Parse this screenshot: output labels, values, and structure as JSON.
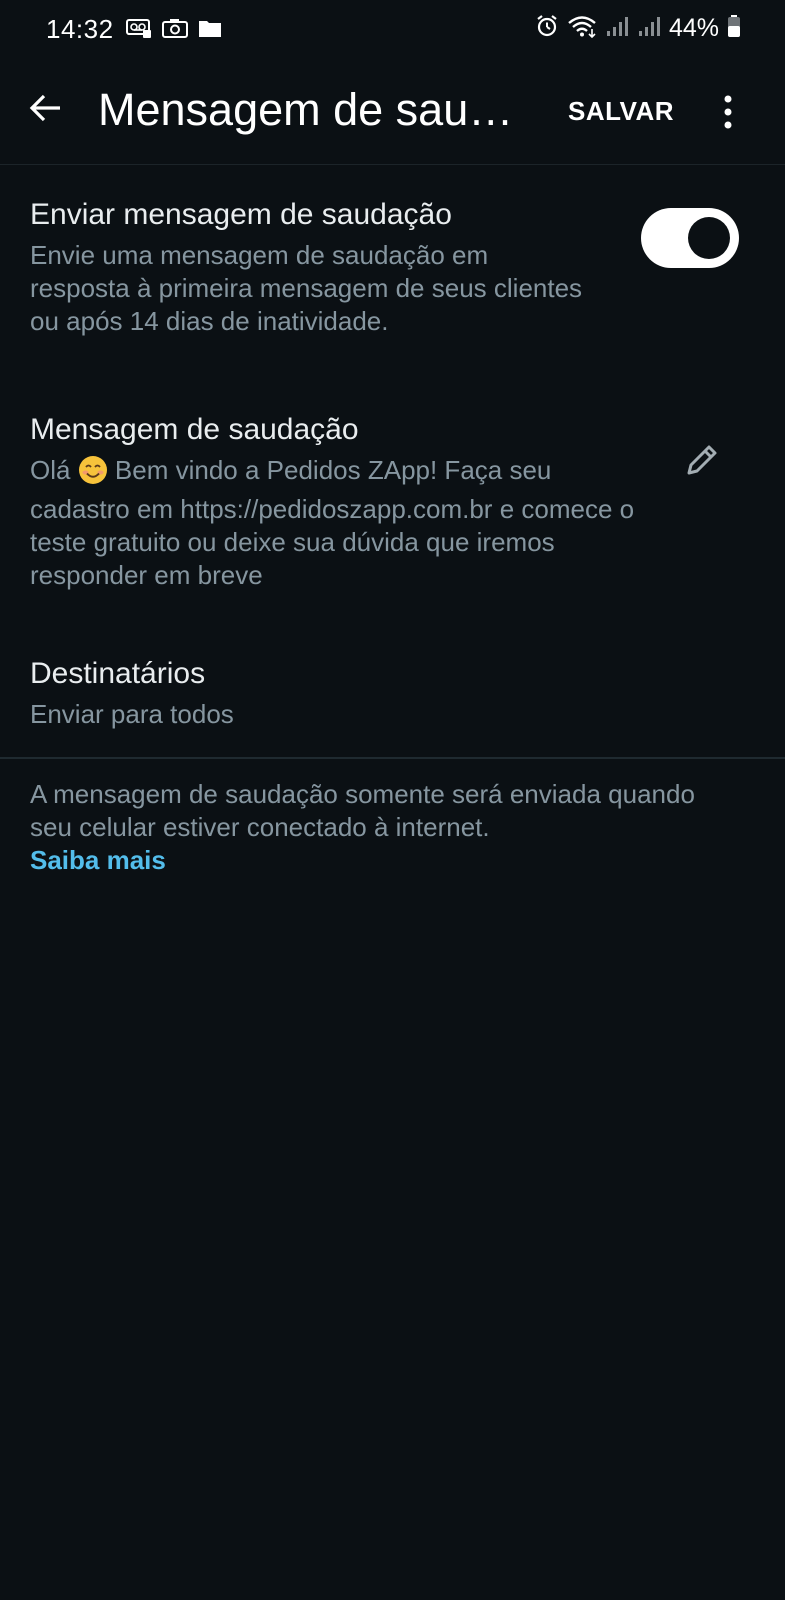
{
  "status_bar": {
    "time": "14:32",
    "battery_percent": "44%",
    "icons_left": [
      "voicemail-icon",
      "camera-icon",
      "folder-icon"
    ],
    "icons_right": [
      "alarm-icon",
      "wifi-icon",
      "signal-icon",
      "signal-icon",
      "battery-icon"
    ]
  },
  "app_bar": {
    "title": "Mensagem de saudação",
    "save_label": "SALVAR"
  },
  "send_greeting": {
    "title": "Enviar mensagem de saudação",
    "description": "Envie uma mensagem de saudação em resposta à primeira mensagem de seus clientes ou após 14 dias de inatividade.",
    "enabled": true
  },
  "greeting_message": {
    "title": "Mensagem de saudação",
    "text_before_emoji": "Olá ",
    "emoji": "smiling-face-emoji",
    "text_after_emoji": " Bem vindo a Pedidos ZApp! Faça seu cadastro em https://pedidoszapp.com.br e comece o teste gratuito ou deixe sua dúvida que iremos responder em breve"
  },
  "recipients": {
    "title": "Destinatários",
    "value": "Enviar para todos"
  },
  "footer": {
    "note": "A mensagem de saudação somente será enviada quando seu celular estiver conectado à internet.",
    "learn_more": "Saiba mais"
  },
  "colors": {
    "background": "#0b1014",
    "primary_text": "#e9edef",
    "secondary_text": "#8696a0",
    "link": "#53bdeb",
    "toggle_on": "#ffffff"
  }
}
